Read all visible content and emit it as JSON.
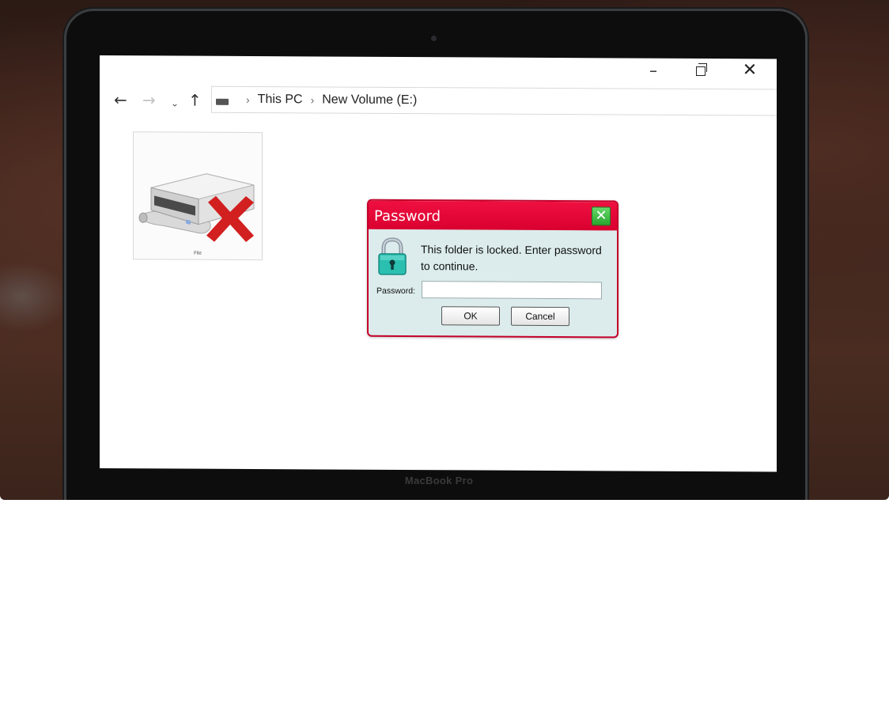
{
  "window": {
    "controls": {
      "minimize": "–",
      "close": "✕"
    }
  },
  "nav": {
    "back": "←",
    "forward": "→",
    "recent": "⌄",
    "up": "↑"
  },
  "breadcrumb": {
    "items": [
      "This PC",
      "New Volume (E:)"
    ],
    "separator": "›"
  },
  "drive_item": {
    "label": "File",
    "icon": "drive-locked-icon"
  },
  "dialog": {
    "title": "Password",
    "close_label": "✕",
    "message": "This folder is locked. Enter password to continue.",
    "password_label": "Password:",
    "password_value": "",
    "ok_label": "OK",
    "cancel_label": "Cancel",
    "lock_icon": "lock-icon",
    "colors": {
      "titlebar": "#e8093b",
      "close": "#3cbf42",
      "body": "#dcecec",
      "lock": "#2bbfb0"
    }
  },
  "device": {
    "brand": "MacBook Pro"
  }
}
